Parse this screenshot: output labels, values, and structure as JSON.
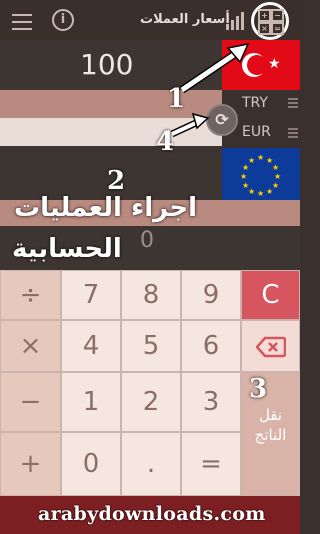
{
  "header": {
    "title": "أسعار العملات"
  },
  "amount": "100",
  "currencies": [
    {
      "code": "TRY"
    },
    {
      "code": "EUR"
    }
  ],
  "calc_display": "0",
  "keypad": {
    "row1": [
      "÷",
      "7",
      "8",
      "9",
      "C"
    ],
    "row2": [
      "×",
      "4",
      "5",
      "6"
    ],
    "row3": [
      "−",
      "1",
      "2",
      "3"
    ],
    "row4": [
      "+",
      "0",
      ".",
      "="
    ],
    "copy_result": [
      "نقل",
      "الناتج"
    ]
  },
  "annotations": {
    "n1": "1",
    "n2": "2",
    "n3": "3",
    "n4": "4",
    "caption_line1": "اجراء العمليات",
    "caption_line2": "الحسابية"
  },
  "watermark": "arabydownloads.com",
  "colors": {
    "turkey_red": "#e30a17",
    "eu_blue": "#0c3b9a",
    "clear_red": "#d7555f",
    "footer": "#7c1f22"
  }
}
